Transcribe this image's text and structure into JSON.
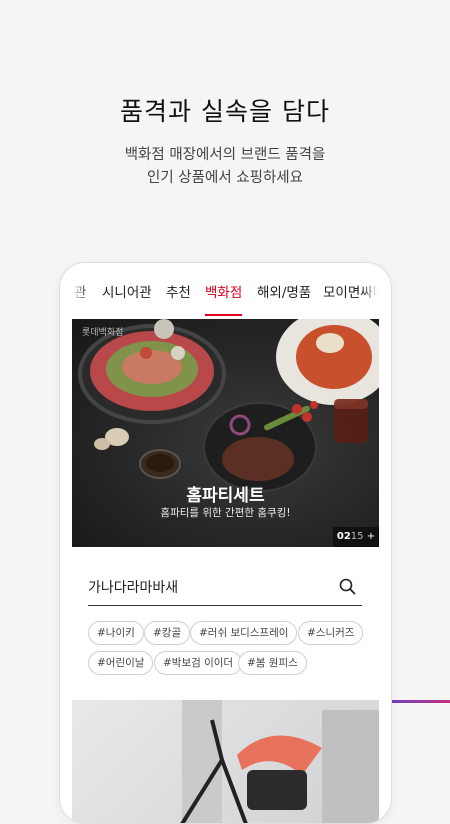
{
  "hero": {
    "headline": "품격과 실속을 담다",
    "sub_line1": "백화점 매장에서의 브랜드 품격을",
    "sub_line2": "인기 상품에서 쇼핑하세요"
  },
  "tabs": [
    {
      "label": "관",
      "active": false
    },
    {
      "label": "시니어관",
      "active": false
    },
    {
      "label": "추천",
      "active": false
    },
    {
      "label": "백화점",
      "active": true
    },
    {
      "label": "해외/명품",
      "active": false
    },
    {
      "label": "모이면싸다",
      "active": false
    }
  ],
  "banner": {
    "brand": "롯데백화점",
    "title": "홈파티세트",
    "description": "홈파티를 위한 간편한 홈쿠킹!",
    "counter_current": "02",
    "counter_total": "15",
    "counter_more": "+"
  },
  "search": {
    "value": "가나다라마바새",
    "placeholder": "",
    "icon": "search-icon"
  },
  "tags": [
    "#나이키",
    "#캉골",
    "#러쉬 보디스프레이",
    "#스니커즈",
    "#어린이날",
    "#박보검 이이더",
    "#봄 원피스"
  ],
  "colors": {
    "accent": "#e0001e",
    "background": "#f7f5f4",
    "gradient_start": "#6b3fc8",
    "gradient_end": "#c2337a"
  }
}
